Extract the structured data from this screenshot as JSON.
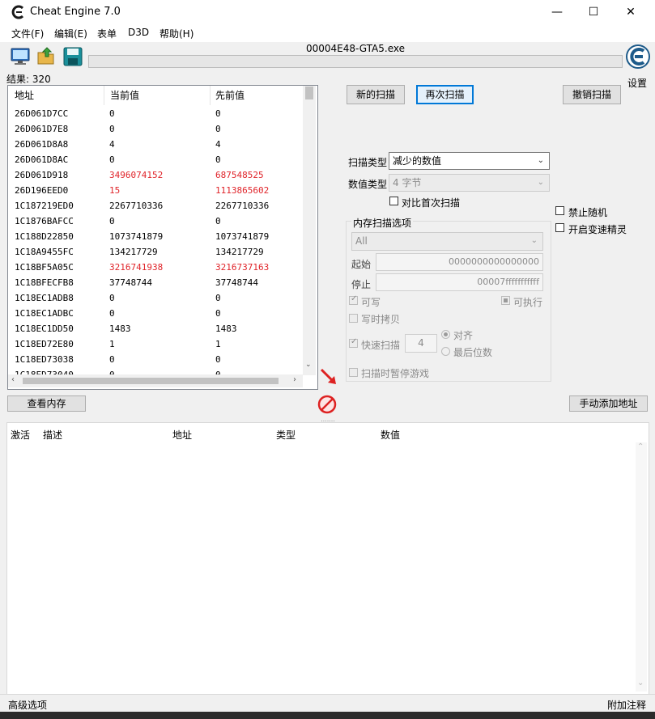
{
  "window": {
    "title": "Cheat Engine 7.0",
    "minimize": "—",
    "maximize": "☐",
    "close": "✕"
  },
  "menu": [
    "文件(F)",
    "编辑(E)",
    "表单",
    "D3D",
    "帮助(H)"
  ],
  "process_name": "00004E48-GTA5.exe",
  "settings_label": "设置",
  "results_label": "结果: 320",
  "results_table": {
    "headers": [
      "地址",
      "当前值",
      "先前值"
    ],
    "rows": [
      {
        "addr": "26D061D7CC",
        "cur": "0",
        "prev": "0",
        "changed": false
      },
      {
        "addr": "26D061D7E8",
        "cur": "0",
        "prev": "0",
        "changed": false
      },
      {
        "addr": "26D061D8A8",
        "cur": "4",
        "prev": "4",
        "changed": false
      },
      {
        "addr": "26D061D8AC",
        "cur": "0",
        "prev": "0",
        "changed": false
      },
      {
        "addr": "26D061D918",
        "cur": "3496074152",
        "prev": "687548525",
        "changed": true
      },
      {
        "addr": "26D196EED0",
        "cur": "15",
        "prev": "1113865602",
        "changed": true
      },
      {
        "addr": "1C187219ED0",
        "cur": "2267710336",
        "prev": "2267710336",
        "changed": false
      },
      {
        "addr": "1C1876BAFCC",
        "cur": "0",
        "prev": "0",
        "changed": false
      },
      {
        "addr": "1C188D22850",
        "cur": "1073741879",
        "prev": "1073741879",
        "changed": false
      },
      {
        "addr": "1C18A9455FC",
        "cur": "134217729",
        "prev": "134217729",
        "changed": false
      },
      {
        "addr": "1C18BF5A05C",
        "cur": "3216741938",
        "prev": "3216737163",
        "changed": true
      },
      {
        "addr": "1C18BFECFB8",
        "cur": "37748744",
        "prev": "37748744",
        "changed": false
      },
      {
        "addr": "1C18EC1ADB8",
        "cur": "0",
        "prev": "0",
        "changed": false
      },
      {
        "addr": "1C18EC1ADBC",
        "cur": "0",
        "prev": "0",
        "changed": false
      },
      {
        "addr": "1C18EC1DD50",
        "cur": "1483",
        "prev": "1483",
        "changed": false
      },
      {
        "addr": "1C18ED72E80",
        "cur": "1",
        "prev": "1",
        "changed": false
      },
      {
        "addr": "1C18ED73038",
        "cur": "0",
        "prev": "0",
        "changed": false
      },
      {
        "addr": "1C18ED73040",
        "cur": "0",
        "prev": "0",
        "changed": false
      }
    ]
  },
  "buttons": {
    "new_scan": "新的扫描",
    "next_scan": "再次扫描",
    "undo_scan": "撤销扫描",
    "view_memory": "查看内存",
    "add_address": "手动添加地址"
  },
  "scan": {
    "scan_type_label": "扫描类型",
    "scan_type_value": "减少的数值",
    "value_type_label": "数值类型",
    "value_type_value": "4 字节",
    "compare_first": "对比首次扫描",
    "disable_random": "禁止随机",
    "speedhack": "开启变速精灵"
  },
  "mem_options": {
    "title": "内存扫描选项",
    "region": "All",
    "start_label": "起始",
    "start_value": "0000000000000000",
    "stop_label": "停止",
    "stop_value": "00007fffffffffff",
    "writable": "可写",
    "executable": "可执行",
    "copy_on_write": "写时拷贝",
    "fast_scan": "快速扫描",
    "fast_scan_value": "4",
    "align": "对齐",
    "last_digits": "最后位数",
    "pause_game": "扫描时暂停游戏"
  },
  "cheat_table": {
    "headers": [
      "激活",
      "描述",
      "地址",
      "类型",
      "数值"
    ]
  },
  "status": {
    "left": "高级选项",
    "right": "附加注释"
  },
  "colors": {
    "changed_value": "#e0242a",
    "focus_border": "#0078d7"
  }
}
